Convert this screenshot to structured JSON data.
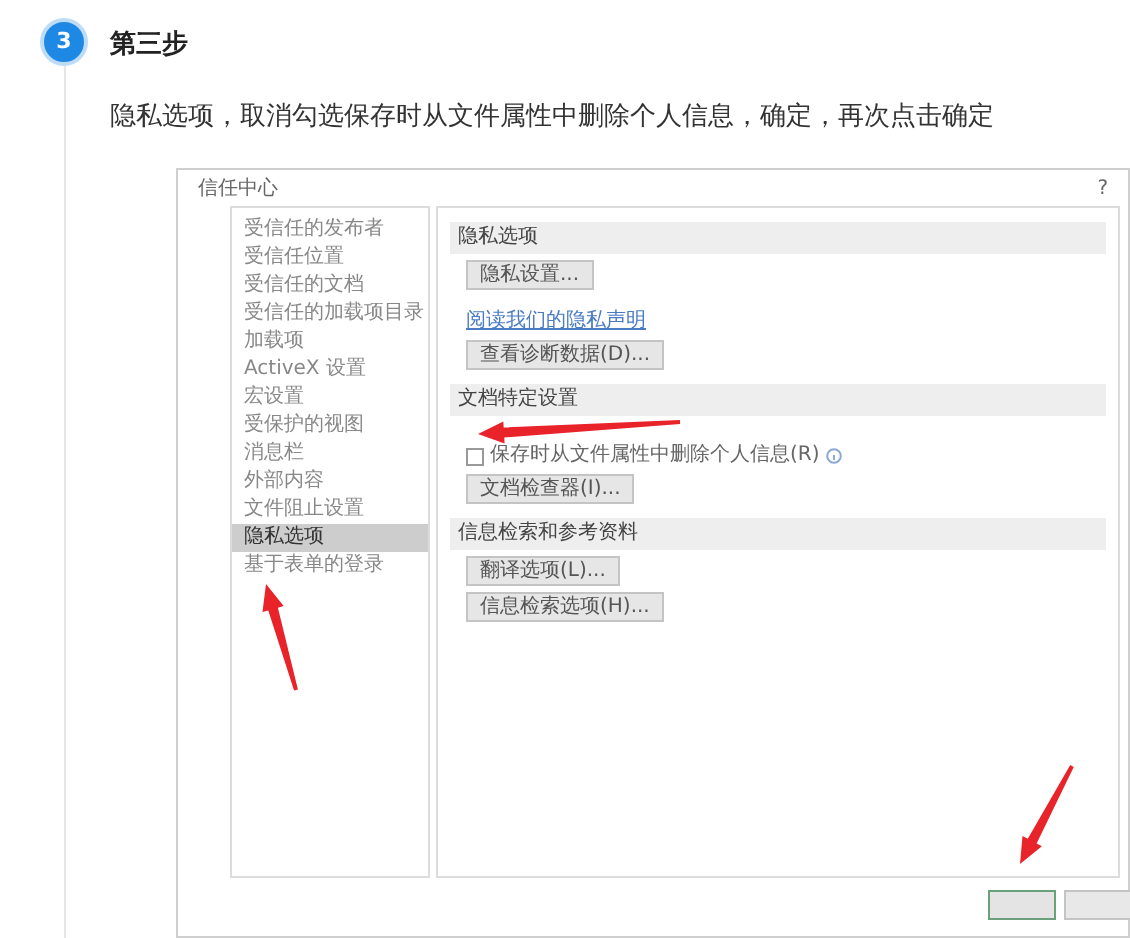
{
  "step": {
    "number": "3",
    "title": "第三步",
    "text": "隐私选项，取消勾选保存时从文件属性中删除个人信息，确定，再次点击确定"
  },
  "dialog": {
    "title": "信任中心",
    "help": "?",
    "sidebar": [
      {
        "label": "受信任的发布者",
        "selected": false
      },
      {
        "label": "受信任位置",
        "selected": false
      },
      {
        "label": "受信任的文档",
        "selected": false
      },
      {
        "label": "受信任的加载项目录",
        "selected": false
      },
      {
        "label": "加载项",
        "selected": false
      },
      {
        "label": "ActiveX 设置",
        "selected": false
      },
      {
        "label": "宏设置",
        "selected": false
      },
      {
        "label": "受保护的视图",
        "selected": false
      },
      {
        "label": "消息栏",
        "selected": false
      },
      {
        "label": "外部内容",
        "selected": false
      },
      {
        "label": "文件阻止设置",
        "selected": false
      },
      {
        "label": "隐私选项",
        "selected": true
      },
      {
        "label": "基于表单的登录",
        "selected": false
      }
    ],
    "content": [
      {
        "kind": "header",
        "text": "隐私选项"
      },
      {
        "kind": "button",
        "text": "隐私设置..."
      },
      {
        "kind": "link",
        "text": "阅读我们的隐私声明"
      },
      {
        "kind": "button",
        "text": "查看诊断数据(D)..."
      },
      {
        "kind": "header",
        "text": "文档特定设置"
      },
      {
        "kind": "checkbox",
        "text": "保存时从文件属性中删除个人信息(R)",
        "checked": false
      },
      {
        "kind": "button",
        "text": "文档检查器(I)..."
      },
      {
        "kind": "header",
        "text": "信息检索和参考资料"
      },
      {
        "kind": "button",
        "text": "翻译选项(L)..."
      },
      {
        "kind": "button",
        "text": "信息检索选项(H)..."
      }
    ],
    "footer_buttons": [
      {
        "kind": "primary"
      },
      {
        "kind": "normal"
      }
    ]
  }
}
